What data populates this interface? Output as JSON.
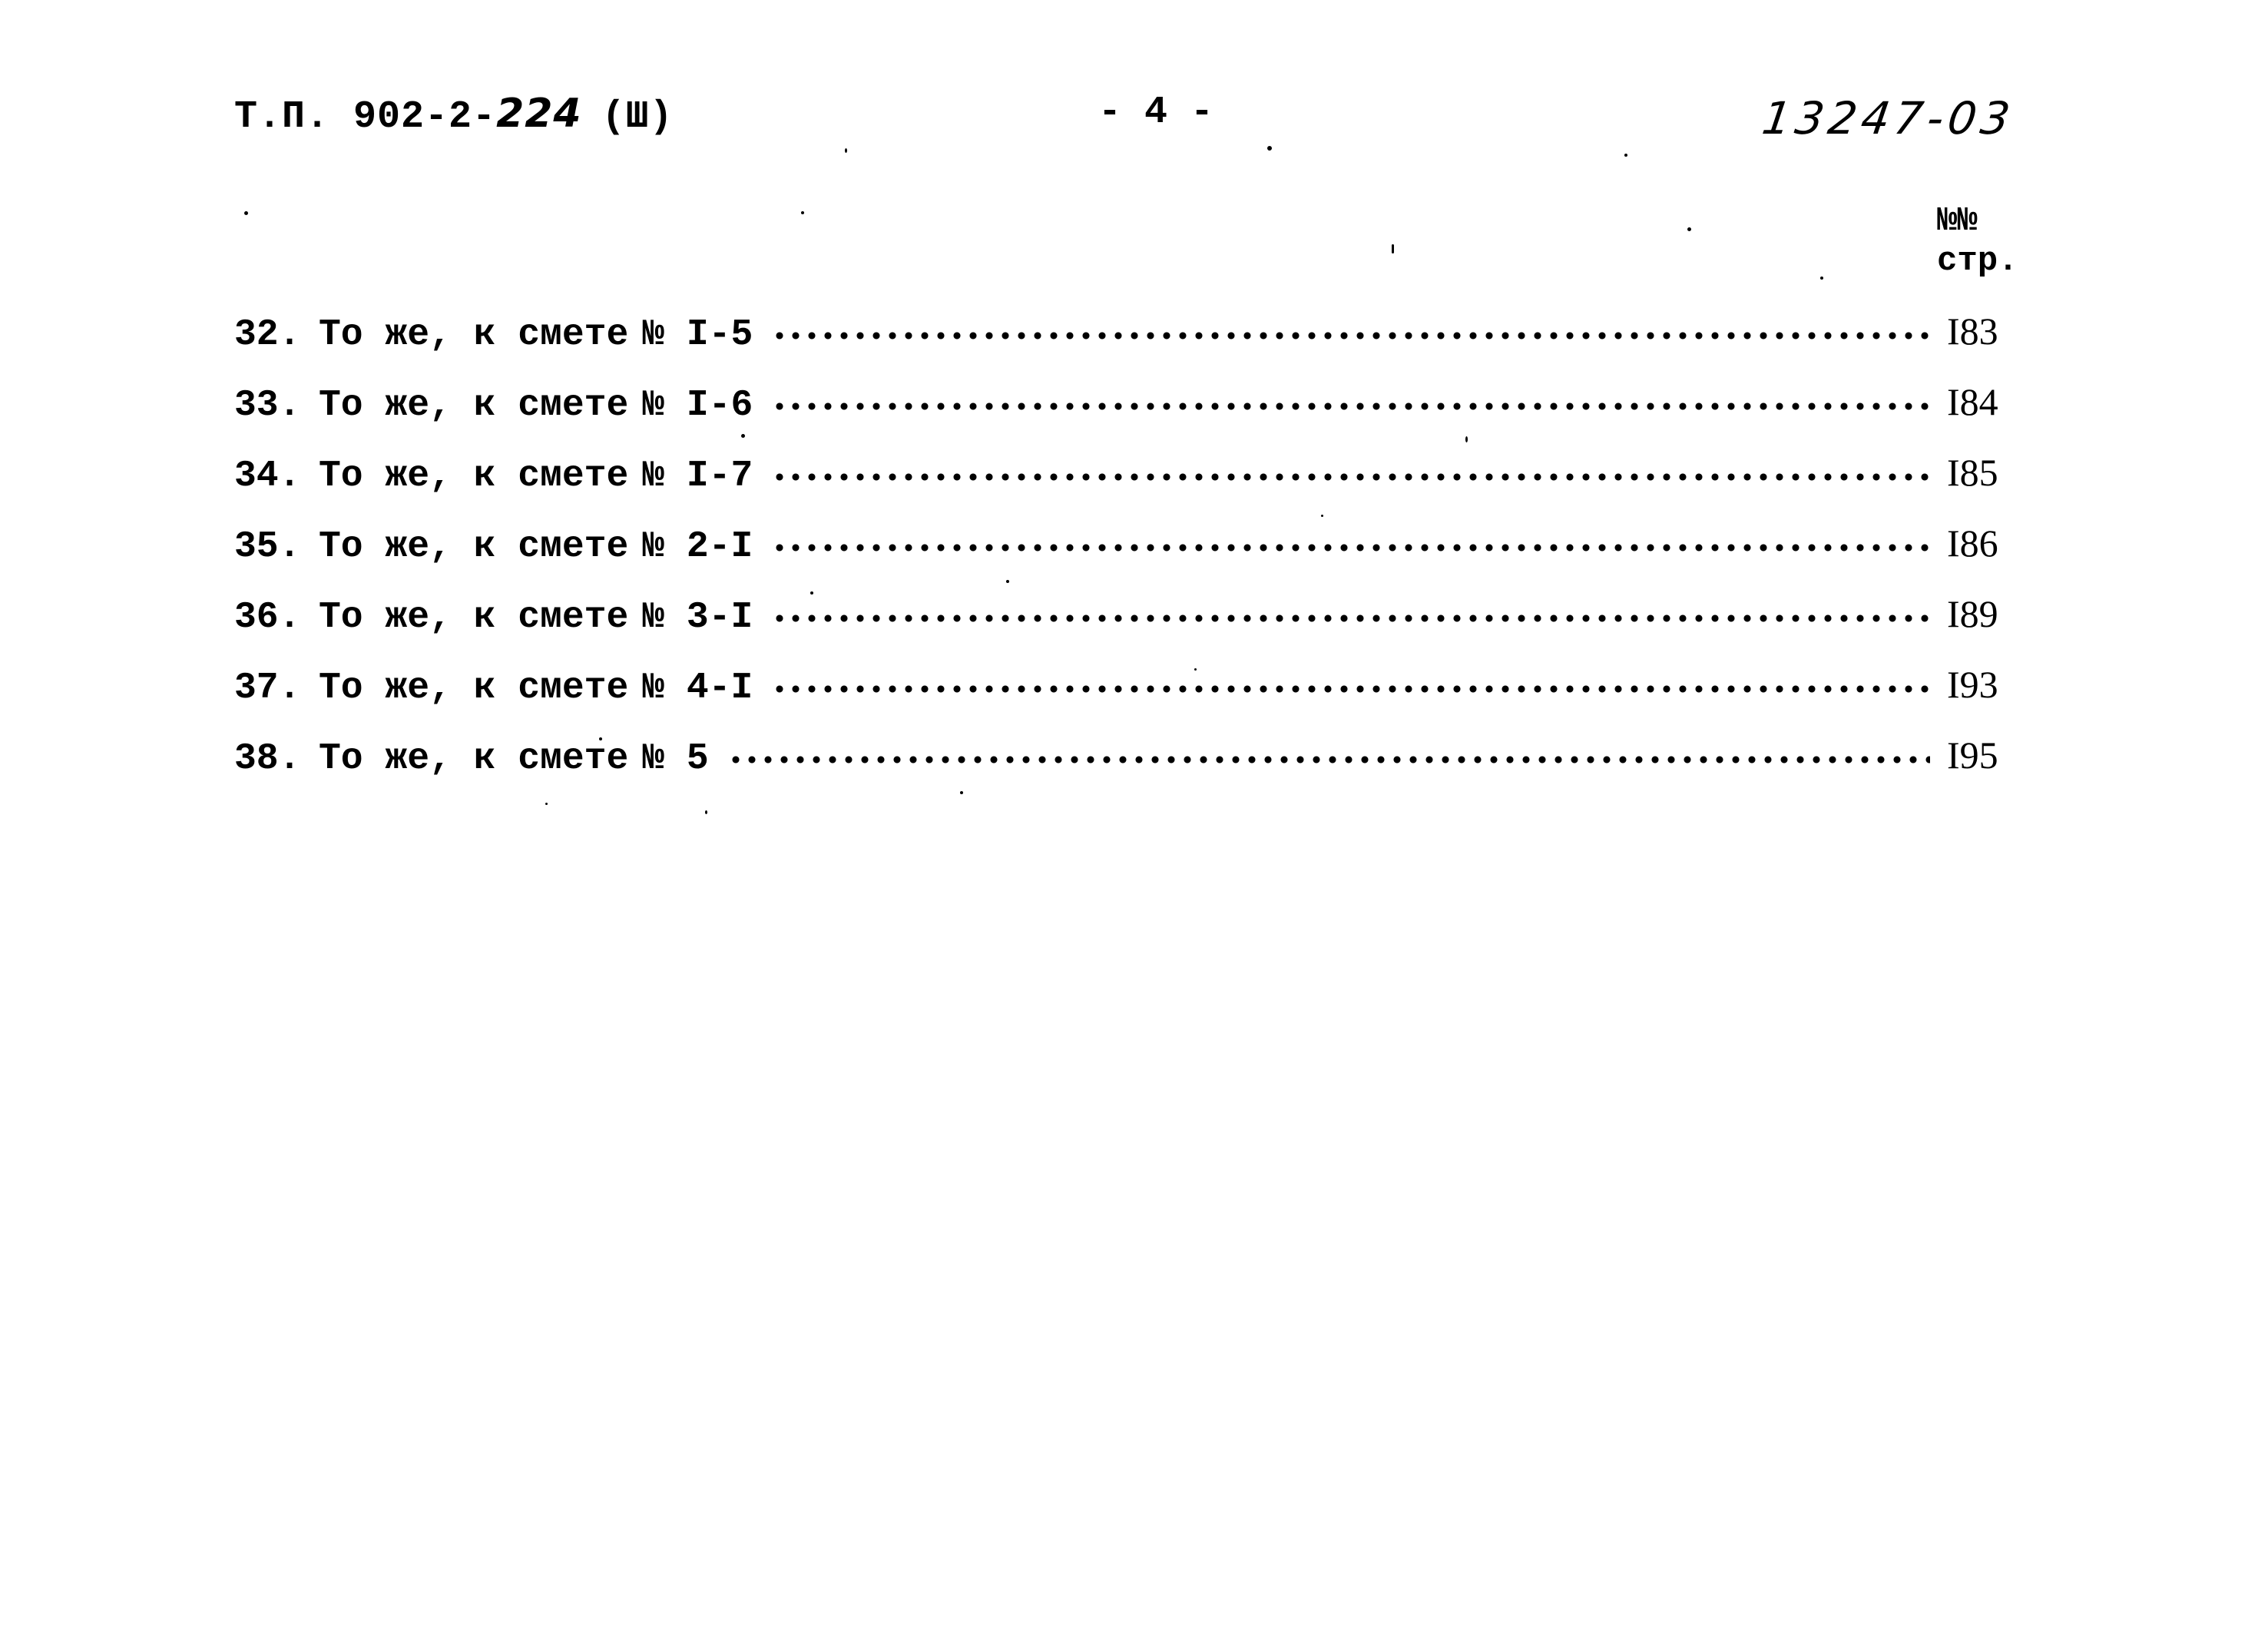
{
  "header": {
    "series_prefix": "Т.П. 902-2-",
    "series_handwritten": "224",
    "volume": "(Ш)",
    "page_number": "- 4 -",
    "document_number": "13247-03"
  },
  "columns": {
    "page_column_label_line1": "№№",
    "page_column_label_line2": "стр."
  },
  "toc": {
    "entries": [
      {
        "number": "32.",
        "title": "То же, к смете",
        "ref": "№ I-5",
        "page": "I83"
      },
      {
        "number": "33.",
        "title": "То же, к смете",
        "ref": "№ I-6",
        "page": "I84"
      },
      {
        "number": "34.",
        "title": "То же, к смете",
        "ref": "№ I-7",
        "page": "I85"
      },
      {
        "number": "35.",
        "title": "То же, к смете",
        "ref": "№ 2-I",
        "page": "I86"
      },
      {
        "number": "36.",
        "title": "То же, к смете",
        "ref": "№ 3-I",
        "page": "I89"
      },
      {
        "number": "37.",
        "title": "То же, к смете",
        "ref": "№ 4-I",
        "page": "I93"
      },
      {
        "number": "38.",
        "title": "То же, к смете",
        "ref": "№ 5",
        "page": "I95"
      }
    ]
  }
}
